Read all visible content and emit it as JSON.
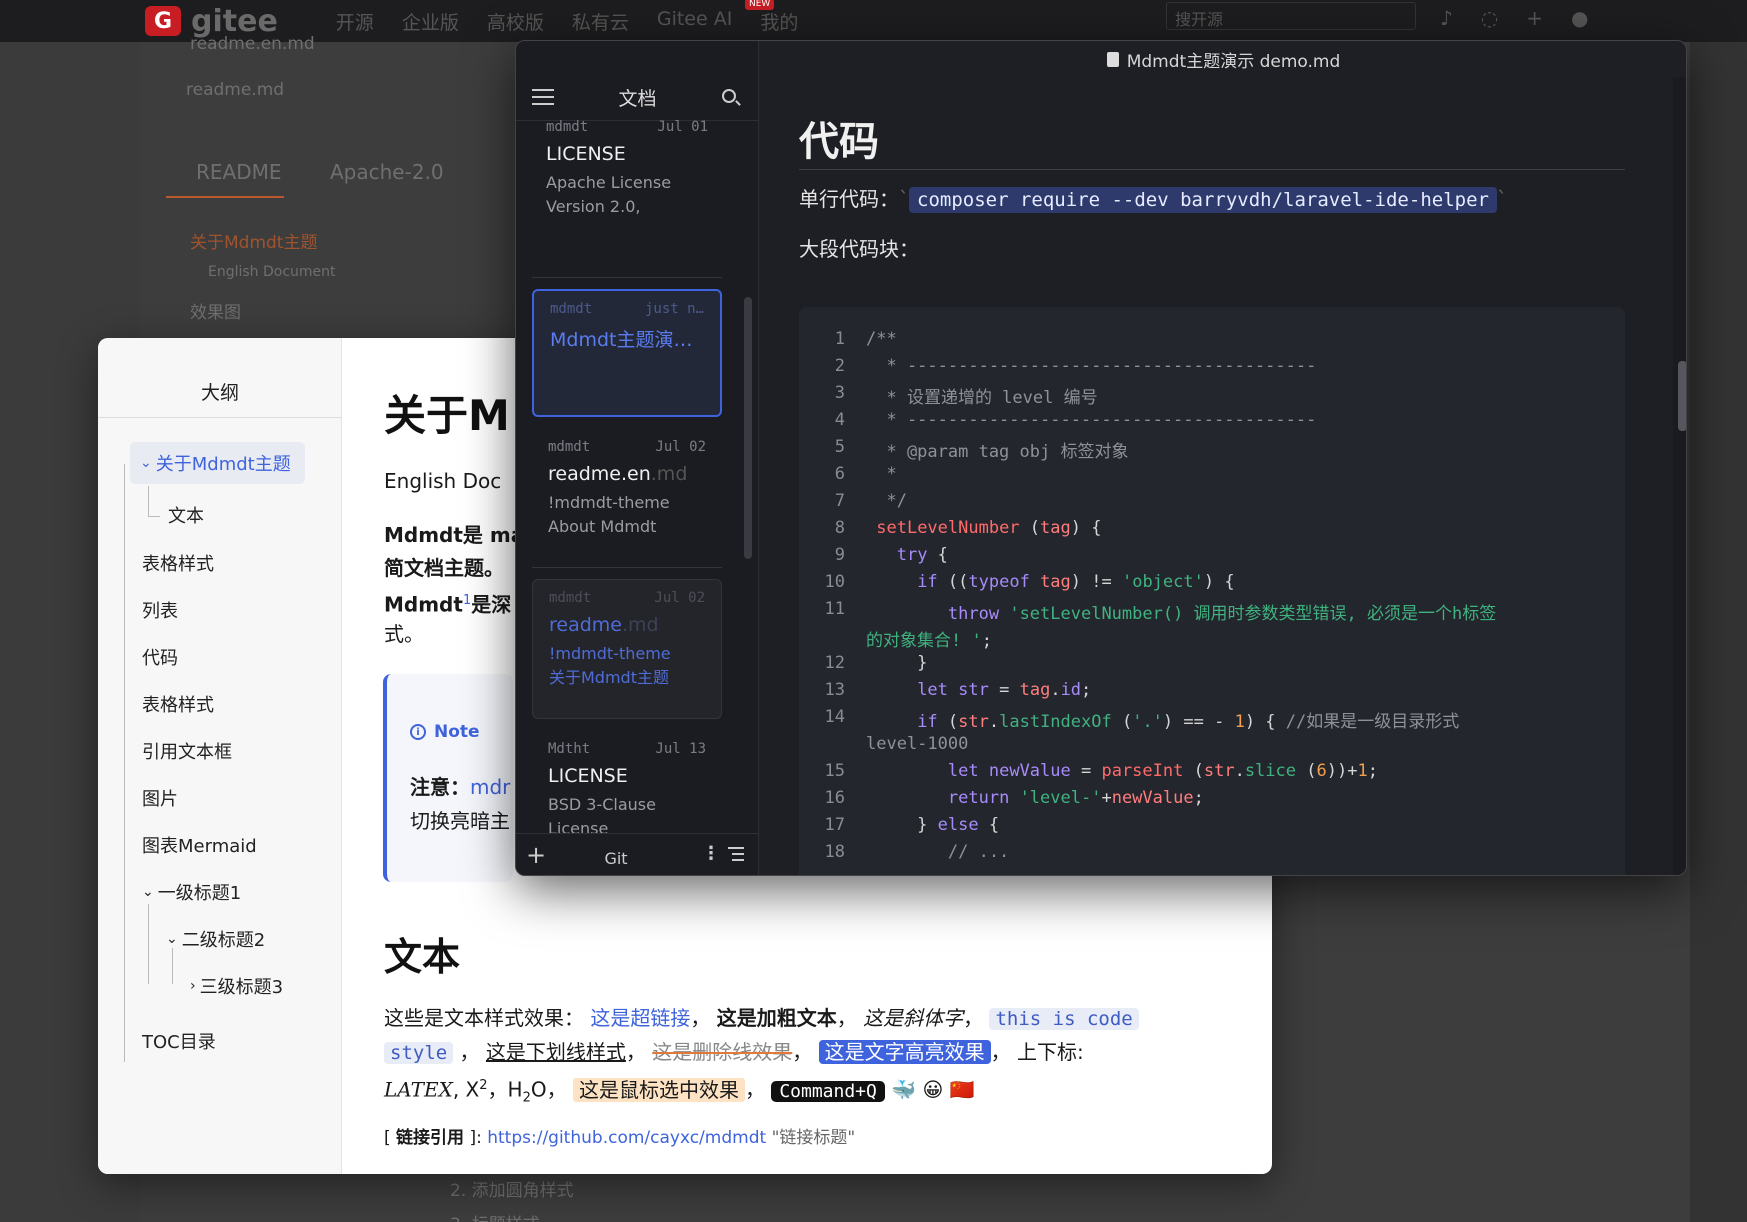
{
  "background": {
    "logo_mark": "G",
    "logo_text": "gitee",
    "nav": [
      "开源",
      "企业版",
      "高校版",
      "私有云",
      "Gitee AI",
      "我的"
    ],
    "nav_badge": "NEW",
    "search_placeholder": "搜开源",
    "file_row_1": "readme.en.md",
    "file_row_2": "readme.md",
    "tab_readme": "README",
    "tab_license": "Apache-2.0",
    "toc_1": "关于Mdmdt主题",
    "toc_2": "English Document",
    "toc_3": "效果图",
    "list_2": "2. 添加圆角样式",
    "list_3": "3. 标题样式"
  },
  "outline_window": {
    "title": "大纲",
    "items": [
      {
        "label": "关于Mdmdt主题",
        "active": true,
        "chevron": "⌄"
      },
      {
        "label": "文本"
      },
      {
        "label": "表格样式"
      },
      {
        "label": "列表"
      },
      {
        "label": "代码"
      },
      {
        "label": "表格样式"
      },
      {
        "label": "引用文本框"
      },
      {
        "label": "图片"
      },
      {
        "label": "图表Mermaid"
      },
      {
        "label": "一级标题1",
        "chevron": "⌄"
      },
      {
        "label": "二级标题2",
        "chevron": "⌄"
      },
      {
        "label": "三级标题3",
        "chevron": "›"
      },
      {
        "label": "TOC目录"
      }
    ],
    "content": {
      "heading": "关于M",
      "english_link": "English Doc",
      "p1": "Mdmdt是 ma",
      "p2": "简文档主题。",
      "p3a": "Mdmdt",
      "p3sup": "1",
      "p3b": "是深",
      "p4": "式。",
      "note_label": "Note",
      "note_icon": "i",
      "note_line1a": "注意：",
      "note_line1b": "mdr",
      "note_line2": "切换亮暗主",
      "text_heading": "文本",
      "text_line1": {
        "intro": "这些是文本样式效果：",
        "link": "这是超链接",
        "bold": "这是加粗文本",
        "italic": "这是斜体字",
        "code1": "this is code"
      },
      "text_line2": {
        "code2": "style",
        "underline": "这是下划线样式",
        "strike": "这是删除线效果",
        "highlight": "这是文字高亮效果",
        "supsub": "上下标:"
      },
      "text_line3": {
        "latex": "LATEX",
        "x": "X",
        "x_sup": "2",
        "h": "H",
        "h_sub": "2",
        "o": "O",
        "selected": "这是鼠标选中效果",
        "kbd": "Command+Q",
        "emoji": "🐳 😀 🇨🇳"
      },
      "ref_line": {
        "open": "[",
        "label": "链接引用",
        "close": "]:",
        "url": "https://github.com/cayxc/mdmdt",
        "title": "\"链接标题\""
      }
    }
  },
  "main_window": {
    "title": "Mdmdt主题演示 demo.md",
    "docs_panel": {
      "title": "文档",
      "cards": [
        {
          "meta_left": "mdmdt",
          "meta_right": "Jul 01",
          "name": "LICENSE",
          "ext": "",
          "desc1": "Apache License",
          "desc2": "Version 2.0,"
        },
        {
          "meta_left": "mdmdt",
          "meta_right": "just n…",
          "name": "Mdmdt主题演…",
          "ext": "",
          "desc1": "",
          "desc2": ""
        },
        {
          "meta_left": "mdmdt",
          "meta_right": "Jul 02",
          "name": "readme.en",
          "ext": ".md",
          "desc1": "!mdmdt-theme",
          "desc2": "About Mdmdt"
        },
        {
          "meta_left": "mdmdt",
          "meta_right": "Jul 02",
          "name": "readme",
          "ext": ".md",
          "desc1": "!mdmdt-theme",
          "desc2": "关于Mdmdt主题"
        },
        {
          "meta_left": "Mdtht",
          "meta_right": "Jul 13",
          "name": "LICENSE",
          "ext": "",
          "desc1": "BSD 3-Clause",
          "desc2": "License"
        }
      ],
      "footer_plus": "+",
      "footer_git": "Git",
      "footer_more": "⋮"
    },
    "editor": {
      "heading": "代码",
      "inline_label": "单行代码：",
      "inline_code": "composer require --dev barryvdh/laravel-ide-helper",
      "block_label": "大段代码块："
    }
  },
  "colors": {
    "accent": "#3e63dd",
    "dark_bg": "#1e1f25",
    "keyword": "#a78bfa",
    "string": "#3fb37f",
    "function": "#ff6b6b"
  }
}
